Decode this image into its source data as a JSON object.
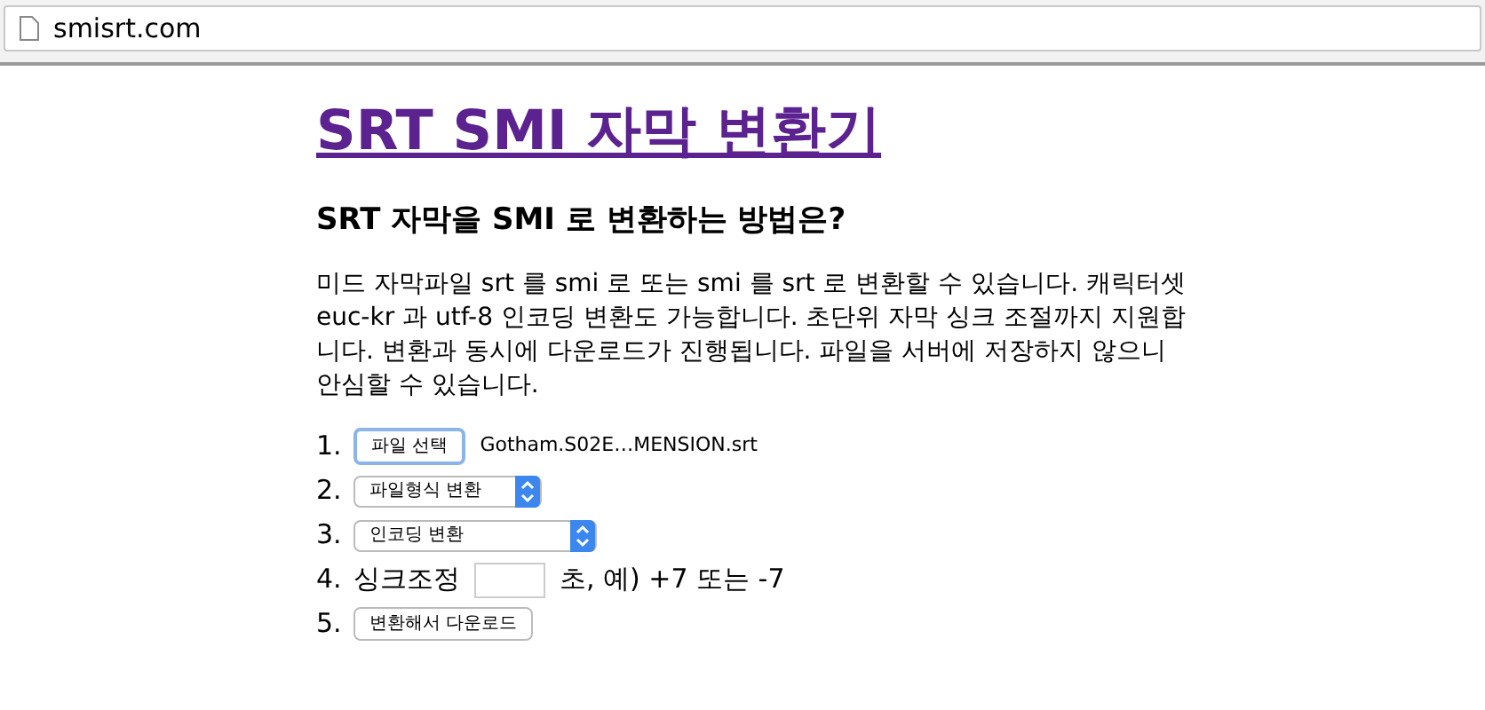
{
  "address_bar": {
    "url": "smisrt.com"
  },
  "title": "SRT SMI 자막 변환기",
  "subtitle": "SRT 자막을 SMI 로 변환하는 방법은?",
  "description": "미드 자막파일 srt 를 smi 로 또는 smi 를 srt 로 변환할 수 있습니다. 캐릭터셋 euc-kr 과 utf-8 인코딩 변환도 가능합니다. 초단위 자막 싱크 조절까지 지원합니다. 변환과 동시에 다운로드가 진행됩니다. 파일을 서버에 저장하지 않으니 안심할 수 있습니다.",
  "steps": [
    {
      "number": "1.",
      "kind": "file",
      "button": "파일 선택",
      "file_name": "Gotham.S02E…MENSION.srt"
    },
    {
      "number": "2.",
      "kind": "select",
      "value": "파일형식 변환"
    },
    {
      "number": "3.",
      "kind": "select",
      "value": "인코딩 변환"
    },
    {
      "number": "4.",
      "kind": "sync",
      "label": "싱크조정",
      "hint": "초, 예) +7 또는 -7"
    },
    {
      "number": "5.",
      "kind": "button",
      "button": "변환해서 다운로드"
    }
  ]
}
